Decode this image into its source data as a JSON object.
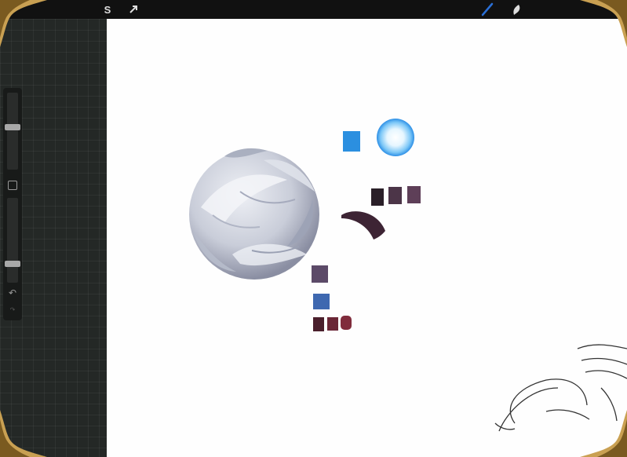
{
  "toolbar": {
    "left_icons": [
      "selection-s-icon",
      "transform-arrow-icon"
    ],
    "right_icons": [
      "brush-icon",
      "smudge-icon"
    ],
    "selection_glyph": "S",
    "accent": "#2a6fd6"
  },
  "sidebar": {
    "brush_size_level": 0.55,
    "opacity_level": 0.2,
    "icons": [
      "modify-square-icon",
      "undo-icon",
      "redo-icon"
    ]
  },
  "canvas": {
    "background": "#fefefe",
    "swatches": {
      "blue": "#2b8fe0",
      "glow_core": "#e6f6ff",
      "glow_edge": "#2d8fe6",
      "dark_row": [
        "#2a1f28",
        "#4c3548",
        "#5e3f58"
      ],
      "purple_small": "#5c4a68",
      "blue_small": "#3e68b0",
      "bottom_row": [
        "#4a1f2c",
        "#6a2636",
        "#802c3c"
      ],
      "crescent": "#3d2434"
    },
    "fur_ball_colors": [
      "#c9cdd9",
      "#eef0f5",
      "#8a8ea2"
    ]
  },
  "frame": {
    "gold": "#c9a052",
    "dark_gold": "#7a5a20"
  }
}
